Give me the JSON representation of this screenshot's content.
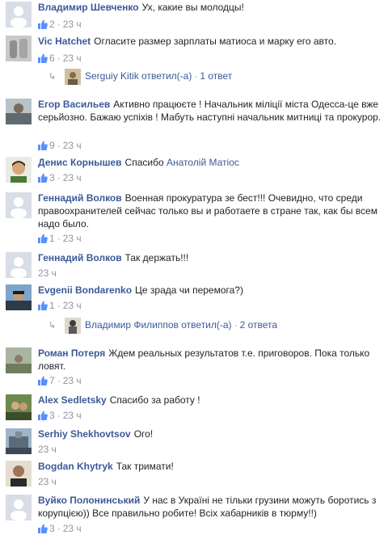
{
  "comments": [
    {
      "name": "Владимир Шевченко",
      "text": "Ух, какие вы молодцы!",
      "likes": "2",
      "time": "23 ч"
    },
    {
      "name": "Vic Hatchet",
      "text": "Огласите размер зарплаты матиоса и марку его авто.",
      "likes": "6",
      "time": "23 ч"
    },
    {
      "name": "Егор Васильев",
      "text": "Активно працюєте ! Начальник міліції міста Одесса-це вже серьйозно. Бажаю успіхів ! Мабуть наступні начальник митниці та прокурор.",
      "likes": "9",
      "time": "23 ч"
    },
    {
      "name": "Денис Корнышев",
      "text": "Спасибо",
      "mention": "Анатолій Матіос",
      "likes": "3",
      "time": "23 ч"
    },
    {
      "name": "Геннадий Волков",
      "text": "Военная прокуратура зе бест!!! Очевидно, что среди правоохранителей сейчас только вы и работаете в стране так, как бы всем надо было.",
      "likes": "1",
      "time": "23 ч"
    },
    {
      "name": "Геннадий Волков",
      "text": "Так держать!!!",
      "time": "23 ч"
    },
    {
      "name": "Evgenii Bondarenko",
      "text": "Це зрада чи перемога?)",
      "likes": "1",
      "time": "23 ч"
    },
    {
      "name": "Роман Потеря",
      "text": "Ждем реальных результатов т.е. приговоров. Пока только ловят.",
      "likes": "7",
      "time": "23 ч"
    },
    {
      "name": "Alex Sedletsky",
      "text": "Спасибо за работу !",
      "likes": "3",
      "time": "23 ч"
    },
    {
      "name": "Serhiy Shekhovtsov",
      "text": "Ого!",
      "time": "23 ч"
    },
    {
      "name": "Bogdan Khytryk",
      "text": "Так тримати!",
      "time": "23 ч"
    },
    {
      "name": "Вуйко Полонинський",
      "text": "У нас в Україні не тільки грузини можуть боротись з корупцією)) Все правильно робите! Всіх хабарників в тюрму!!)",
      "likes": "3",
      "time": "23 ч"
    }
  ],
  "replies": [
    {
      "author": "Serguiy Kitik",
      "action": "ответил(-а)",
      "count": "1 ответ"
    },
    {
      "author": "Владимир Филиппов",
      "action": "ответил(-а)",
      "count": "2 ответа"
    }
  ],
  "colors": {
    "link": "#3b5998",
    "meta": "#90949c",
    "text": "#1d2129"
  }
}
